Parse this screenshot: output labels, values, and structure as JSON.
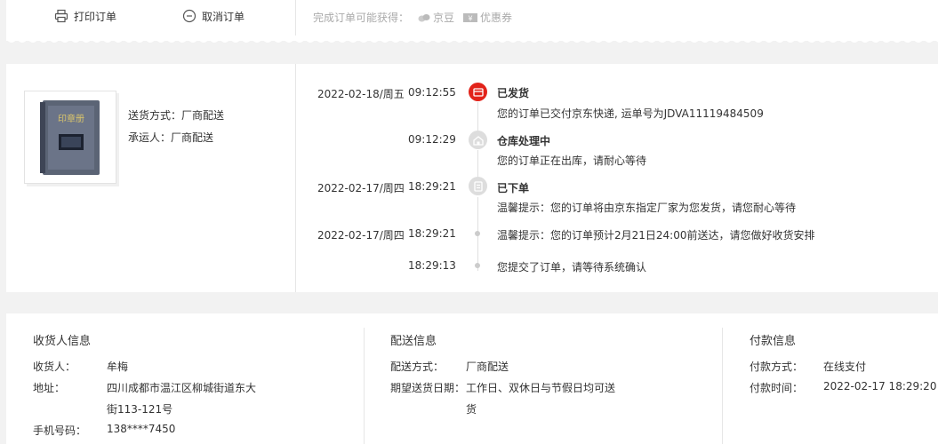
{
  "toolbar": {
    "print_label": "打印订单",
    "cancel_label": "取消订单",
    "reward_prefix": "完成订单可能获得：",
    "reward_beans": "京豆",
    "reward_coupon": "优惠券"
  },
  "shipping": {
    "method_label": "送货方式：",
    "method_value": "厂商配送",
    "carrier_label": "承运人：",
    "carrier_value": "厂商配送"
  },
  "timeline": [
    {
      "date": "2022-02-18/周五",
      "time": "09:12:55",
      "title": "已发货",
      "desc": "您的订单已交付京东快递, 运单号为JDVA11119484509",
      "icon": "shipped-icon",
      "active": true
    },
    {
      "date": "",
      "time": "09:12:29",
      "title": "仓库处理中",
      "desc": "您的订单正在出库，请耐心等待",
      "icon": "warehouse-icon",
      "active": false
    },
    {
      "date": "2022-02-17/周四",
      "time": "18:29:21",
      "title": "已下单",
      "desc": "温馨提示：您的订单将由京东指定厂家为您发货，请您耐心等待",
      "icon": "order-icon",
      "active": false
    },
    {
      "date": "2022-02-17/周四",
      "time": "18:29:21",
      "title": "",
      "desc": "温馨提示：您的订单预计2月21日24:00前送达，请您做好收货安排",
      "icon": "",
      "active": false
    },
    {
      "date": "",
      "time": "18:29:13",
      "title": "",
      "desc": "您提交了订单，请等待系统确认",
      "icon": "",
      "active": false
    }
  ],
  "receiver": {
    "title": "收货人信息",
    "name_label": "收货人：",
    "name_value": "牟梅",
    "addr_label": "地址：",
    "addr_line1": "四川成都市温江区柳城街道东大",
    "addr_line2": "街113-121号",
    "phone_label": "手机号码：",
    "phone_value": "138****7450"
  },
  "delivery": {
    "title": "配送信息",
    "method_label": "配送方式：",
    "method_value": "厂商配送",
    "date_label": "期望送货日期：",
    "date_line1": "工作日、双休日与节假日均可送",
    "date_line2": "货"
  },
  "payment": {
    "title": "付款信息",
    "method_label": "付款方式：",
    "method_value": "在线支付",
    "time_label": "付款时间：",
    "time_value": "2022-02-17 18:29:20"
  },
  "colors": {
    "accent": "#e2231a",
    "muted": "#cccccc"
  }
}
